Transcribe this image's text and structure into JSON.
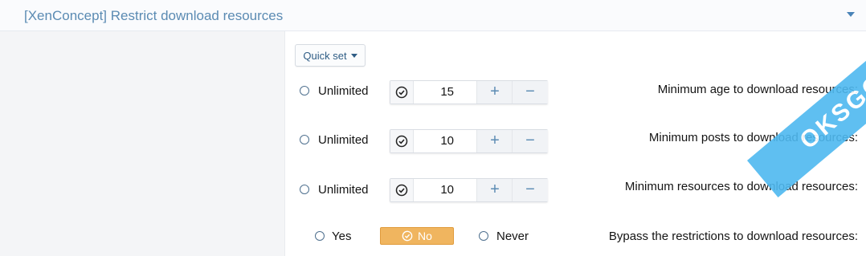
{
  "header": {
    "title": "[XenConcept] Restrict download resources"
  },
  "quick_set_label": "Quick set",
  "rows": [
    {
      "label": "Minimum age to download resources:",
      "unlimited_label": "Unlimited",
      "value": "15",
      "plus": "+",
      "minus": "−"
    },
    {
      "label": "Minimum posts to download resources:",
      "unlimited_label": "Unlimited",
      "value": "10",
      "plus": "+",
      "minus": "−"
    },
    {
      "label": "Minimum resources to download resources:",
      "unlimited_label": "Unlimited",
      "value": "10",
      "plus": "+",
      "minus": "−"
    }
  ],
  "bypass": {
    "label": "Bypass the restrictions to download resources:",
    "yes": "Yes",
    "no": "No",
    "never": "Never",
    "selected": "No"
  },
  "watermark_text": "OKSGO",
  "colors": {
    "accent": "#5b8bb3",
    "selected": "#f0b55f",
    "watermark": "#4eb9f0"
  }
}
